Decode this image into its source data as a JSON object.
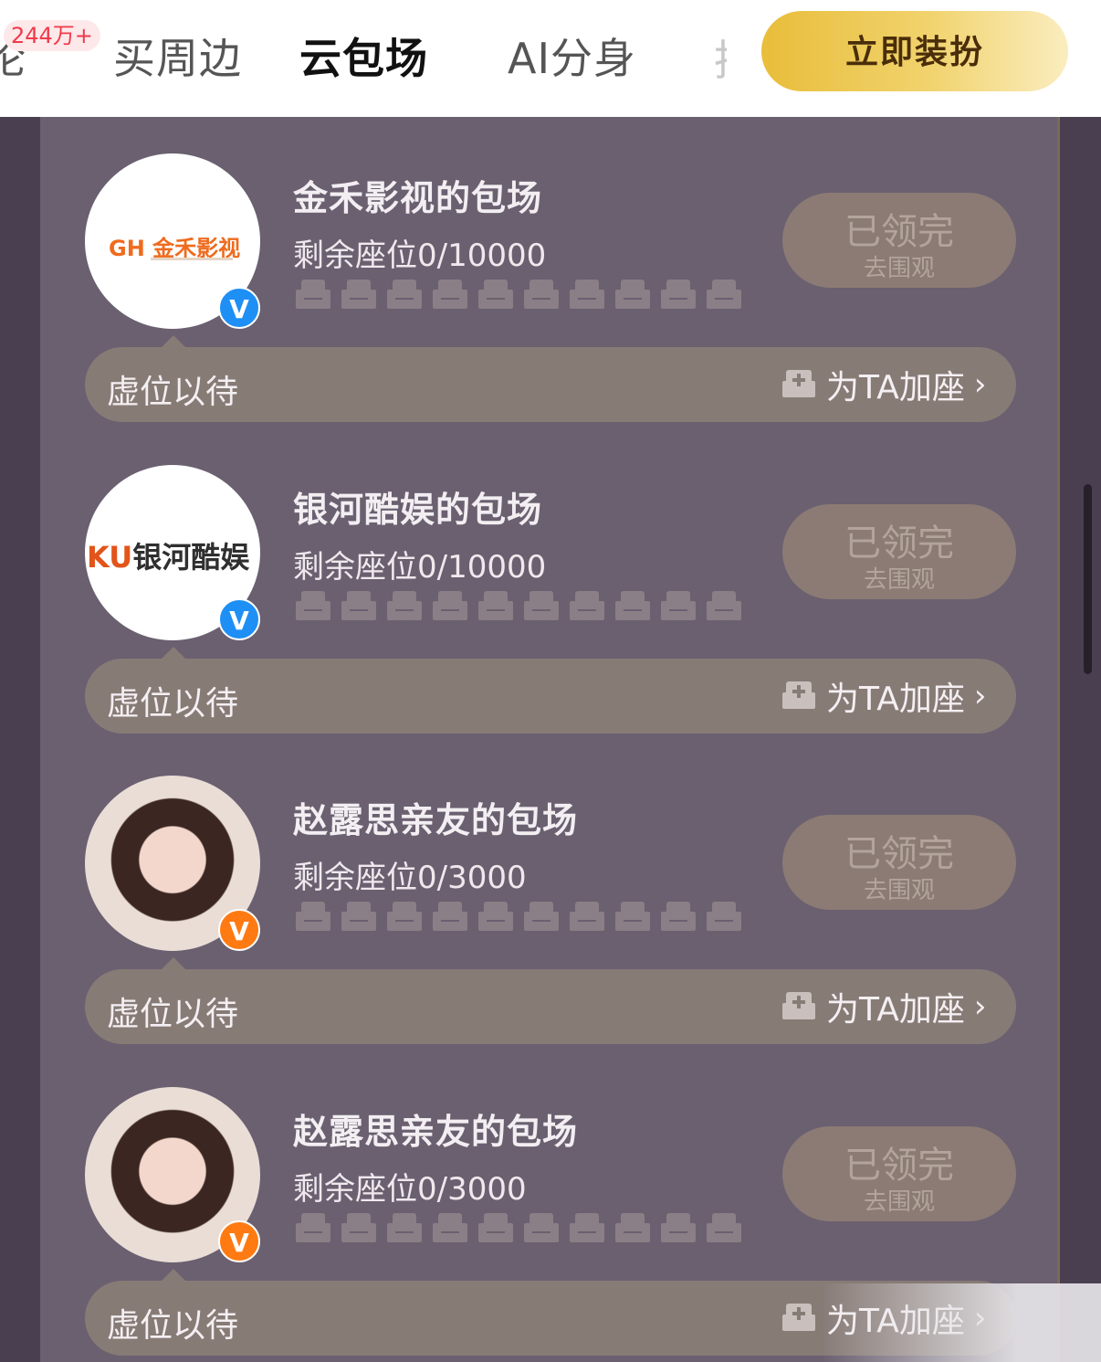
{
  "tabs": [
    {
      "label": "买周边",
      "active": false
    },
    {
      "label": "云包场",
      "active": true
    },
    {
      "label": "AI分身",
      "active": false
    }
  ],
  "tab_badge": "244万+",
  "cta_label": "立即装扮",
  "cards": [
    {
      "title": "金禾影视的包场",
      "seats": "剩余座位0/10000",
      "status": "已领完",
      "status_sub": "去围观",
      "bar_label": "虚位以待",
      "add_label": "为TA加座",
      "verify": "blue",
      "logo_text": "金禾影视"
    },
    {
      "title": "银河酷娱的包场",
      "seats": "剩余座位0/10000",
      "status": "已领完",
      "status_sub": "去围观",
      "bar_label": "虚位以待",
      "add_label": "为TA加座",
      "verify": "blue",
      "logo_text": "银河酷娱"
    },
    {
      "title": "赵露思亲友的包场",
      "seats": "剩余座位0/3000",
      "status": "已领完",
      "status_sub": "去围观",
      "bar_label": "虚位以待",
      "add_label": "为TA加座",
      "verify": "orange"
    },
    {
      "title": "赵露思亲友的包场",
      "seats": "剩余座位0/3000",
      "status": "已领完",
      "status_sub": "去围观",
      "bar_label": "虚位以待",
      "add_label": "为TA加座",
      "verify": "orange"
    }
  ],
  "colors": {
    "accent": "#e8bd3a",
    "panel": "#6a6070",
    "badge_red": "#ef3a4a",
    "verify_blue": "#1e8ff5",
    "verify_orange": "#ff7a12"
  },
  "icons": {
    "seat": "sofa-icon",
    "add_seat": "sofa-plus-icon",
    "chevron": "chevron-right-icon",
    "verify": "verified-v-icon"
  }
}
